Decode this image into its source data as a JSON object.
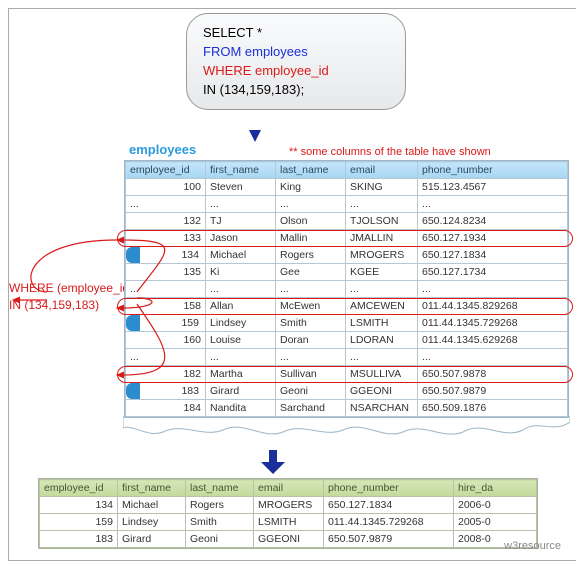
{
  "sql": {
    "line1": "SELECT *",
    "line2": "FROM employees",
    "line3": "WHERE employee_id",
    "line4": "IN (134,159,183);"
  },
  "labels": {
    "employees": "employees",
    "note": "** some columns of the table have shown",
    "where_line1": "WHERE (employee_id)",
    "where_line2": "IN (134,159,183)",
    "footer": "w3resource"
  },
  "columns": {
    "employee_id": "employee_id",
    "first_name": "first_name",
    "last_name": "last_name",
    "email": "email",
    "phone_number": "phone_number",
    "hire_date_trunc": "hire_da"
  },
  "ellipsis": "...",
  "rows": {
    "r100": {
      "id": "100",
      "fn": "Steven",
      "ln": "King",
      "em": "SKING",
      "ph": "515.123.4567"
    },
    "r132": {
      "id": "132",
      "fn": "TJ",
      "ln": "Olson",
      "em": "TJOLSON",
      "ph": "650.124.8234"
    },
    "r133": {
      "id": "133",
      "fn": "Jason",
      "ln": "Mallin",
      "em": "JMALLIN",
      "ph": "650.127.1934"
    },
    "r134": {
      "id": "134",
      "fn": "Michael",
      "ln": "Rogers",
      "em": "MROGERS",
      "ph": "650.127.1834"
    },
    "r135": {
      "id": "135",
      "fn": "Ki",
      "ln": "Gee",
      "em": "KGEE",
      "ph": "650.127.1734"
    },
    "r158": {
      "id": "158",
      "fn": "Allan",
      "ln": "McEwen",
      "em": "AMCEWEN",
      "ph": "011.44.1345.829268"
    },
    "r159": {
      "id": "159",
      "fn": "Lindsey",
      "ln": "Smith",
      "em": "LSMITH",
      "ph": "011.44.1345.729268"
    },
    "r160": {
      "id": "160",
      "fn": "Louise",
      "ln": "Doran",
      "em": "LDORAN",
      "ph": "011.44.1345.629268"
    },
    "r182": {
      "id": "182",
      "fn": "Martha",
      "ln": "Sullivan",
      "em": "MSULLIVA",
      "ph": "650.507.9878"
    },
    "r183": {
      "id": "183",
      "fn": "Girard",
      "ln": "Geoni",
      "em": "GGEONI",
      "ph": "650.507.9879"
    },
    "r184": {
      "id": "184",
      "fn": "Nandita",
      "ln": "Sarchand",
      "em": "NSARCHAN",
      "ph": "650.509.1876"
    }
  },
  "result": {
    "r134": {
      "id": "134",
      "fn": "Michael",
      "ln": "Rogers",
      "em": "MROGERS",
      "ph": "650.127.1834",
      "hd": "2006-0"
    },
    "r159": {
      "id": "159",
      "fn": "Lindsey",
      "ln": "Smith",
      "em": "LSMITH",
      "ph": "011.44.1345.729268",
      "hd": "2005-0"
    },
    "r183": {
      "id": "183",
      "fn": "Girard",
      "ln": "Geoni",
      "em": "GGEONI",
      "ph": "650.507.9879",
      "hd": "2008-0"
    }
  },
  "chart_data": {
    "type": "table",
    "description": "SQL demo: SELECT * FROM employees WHERE employee_id IN (134,159,183); showing a source employees table excerpt and the 3-row filtered result.",
    "source_table_name": "employees",
    "visible_columns": [
      "employee_id",
      "first_name",
      "last_name",
      "email",
      "phone_number"
    ],
    "source_rows_shown": [
      {
        "employee_id": 100,
        "first_name": "Steven",
        "last_name": "King",
        "email": "SKING",
        "phone_number": "515.123.4567"
      },
      {
        "employee_id": 132,
        "first_name": "TJ",
        "last_name": "Olson",
        "email": "TJOLSON",
        "phone_number": "650.124.8234"
      },
      {
        "employee_id": 133,
        "first_name": "Jason",
        "last_name": "Mallin",
        "email": "JMALLIN",
        "phone_number": "650.127.1934"
      },
      {
        "employee_id": 134,
        "first_name": "Michael",
        "last_name": "Rogers",
        "email": "MROGERS",
        "phone_number": "650.127.1834"
      },
      {
        "employee_id": 135,
        "first_name": "Ki",
        "last_name": "Gee",
        "email": "KGEE",
        "phone_number": "650.127.1734"
      },
      {
        "employee_id": 158,
        "first_name": "Allan",
        "last_name": "McEwen",
        "email": "AMCEWEN",
        "phone_number": "011.44.1345.829268"
      },
      {
        "employee_id": 159,
        "first_name": "Lindsey",
        "last_name": "Smith",
        "email": "LSMITH",
        "phone_number": "011.44.1345.729268"
      },
      {
        "employee_id": 160,
        "first_name": "Louise",
        "last_name": "Doran",
        "email": "LDORAN",
        "phone_number": "011.44.1345.629268"
      },
      {
        "employee_id": 182,
        "first_name": "Martha",
        "last_name": "Sullivan",
        "email": "MSULLIVA",
        "phone_number": "650.507.9878"
      },
      {
        "employee_id": 183,
        "first_name": "Girard",
        "last_name": "Geoni",
        "email": "GGEONI",
        "phone_number": "650.507.9879"
      },
      {
        "employee_id": 184,
        "first_name": "Nandita",
        "last_name": "Sarchand",
        "email": "NSARCHAN",
        "phone_number": "650.509.1876"
      }
    ],
    "highlighted_ids": [
      134,
      159,
      183
    ],
    "result_columns_truncated": [
      "employee_id",
      "first_name",
      "last_name",
      "email",
      "phone_number",
      "hire_da"
    ],
    "result_rows": [
      {
        "employee_id": 134,
        "first_name": "Michael",
        "last_name": "Rogers",
        "email": "MROGERS",
        "phone_number": "650.127.1834",
        "hire_date_partial": "2006-0"
      },
      {
        "employee_id": 159,
        "first_name": "Lindsey",
        "last_name": "Smith",
        "email": "LSMITH",
        "phone_number": "011.44.1345.729268",
        "hire_date_partial": "2005-0"
      },
      {
        "employee_id": 183,
        "first_name": "Girard",
        "last_name": "Geoni",
        "email": "GGEONI",
        "phone_number": "650.507.9879",
        "hire_date_partial": "2008-0"
      }
    ]
  }
}
